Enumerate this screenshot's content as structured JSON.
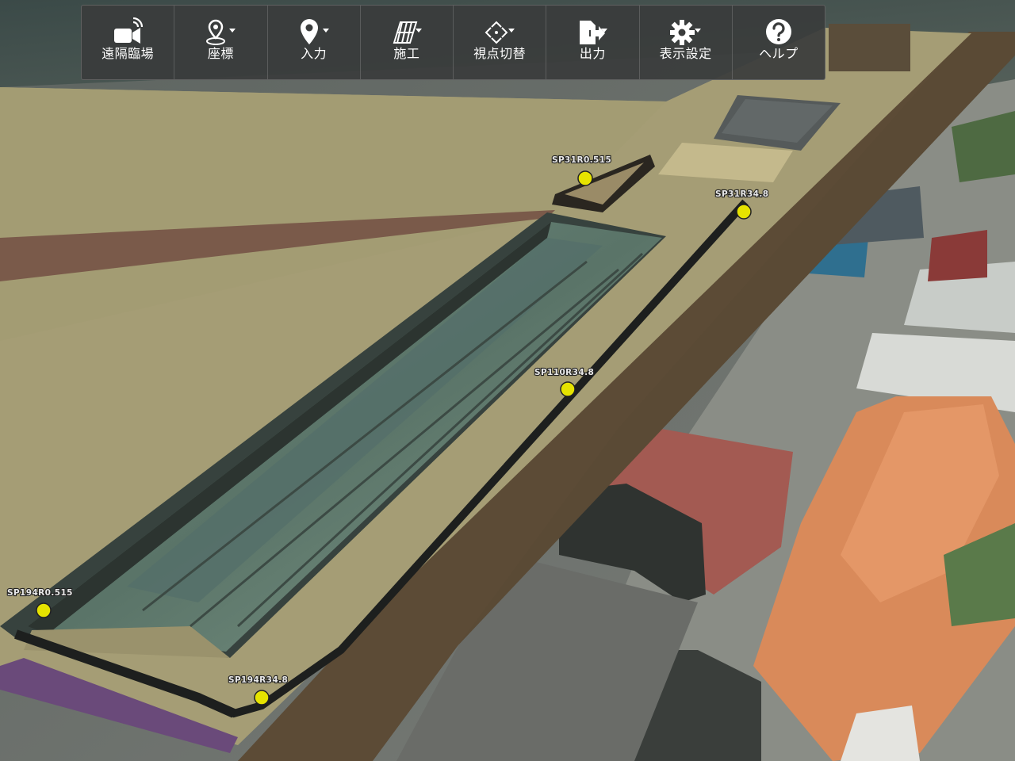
{
  "toolbar": {
    "items": [
      {
        "label": "遠隔臨場",
        "icon": "video-camera-icon",
        "has_dropdown": false
      },
      {
        "label": "座標",
        "icon": "map-pin-coordinate-icon",
        "has_dropdown": true
      },
      {
        "label": "入力",
        "icon": "location-pin-icon",
        "has_dropdown": true
      },
      {
        "label": "施工",
        "icon": "construction-layer-icon",
        "has_dropdown": true
      },
      {
        "label": "視点切替",
        "icon": "viewpoint-switch-icon",
        "has_dropdown": true
      },
      {
        "label": "出力",
        "icon": "export-file-icon",
        "has_dropdown": true
      },
      {
        "label": "表示設定",
        "icon": "gear-icon",
        "has_dropdown": true
      },
      {
        "label": "ヘルプ",
        "icon": "help-icon",
        "has_dropdown": false
      }
    ]
  },
  "survey_points": [
    {
      "label": "SP31R0.515"
    },
    {
      "label": "SP31R34.8"
    },
    {
      "label": "SP110R34.8"
    },
    {
      "label": "SP194R0.515"
    },
    {
      "label": "SP194R34.8"
    }
  ],
  "colors": {
    "marker": "#e6e300",
    "toolbar_bg": "#3a3c3c",
    "ground": "#a59d75",
    "road": "#5a4a35",
    "roof_orange": "#d98a5a",
    "roof_red": "#a35a52"
  }
}
